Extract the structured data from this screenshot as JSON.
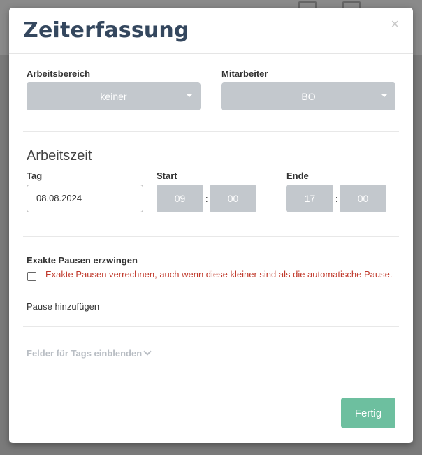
{
  "modal": {
    "title": "Zeiterfassung",
    "close_symbol": "×"
  },
  "fields": {
    "arbeitsbereich_label": "Arbeitsbereich",
    "arbeitsbereich_value": "keiner",
    "mitarbeiter_label": "Mitarbeiter",
    "mitarbeiter_value": "BO"
  },
  "arbeitszeit": {
    "section_title": "Arbeitszeit",
    "tag_label": "Tag",
    "tag_value": "08.08.2024",
    "start_label": "Start",
    "start_hour": "09",
    "start_minute": "00",
    "ende_label": "Ende",
    "ende_hour": "17",
    "ende_minute": "00",
    "separator": ":"
  },
  "pausen": {
    "label": "Exakte Pausen erzwingen",
    "checkbox_checked": false,
    "checkbox_text": "Exakte Pausen verrechnen, auch wenn diese kleiner sind als die automatische Pause.",
    "add_pause": "Pause hinzufügen"
  },
  "tags": {
    "toggle_label": "Felder für Tags einblenden"
  },
  "footer": {
    "done_label": "Fertig"
  },
  "colors": {
    "title": "#34475e",
    "select_bg": "#c3c8cd",
    "warning": "#c0392b",
    "primary_button": "#6dbf9f"
  }
}
